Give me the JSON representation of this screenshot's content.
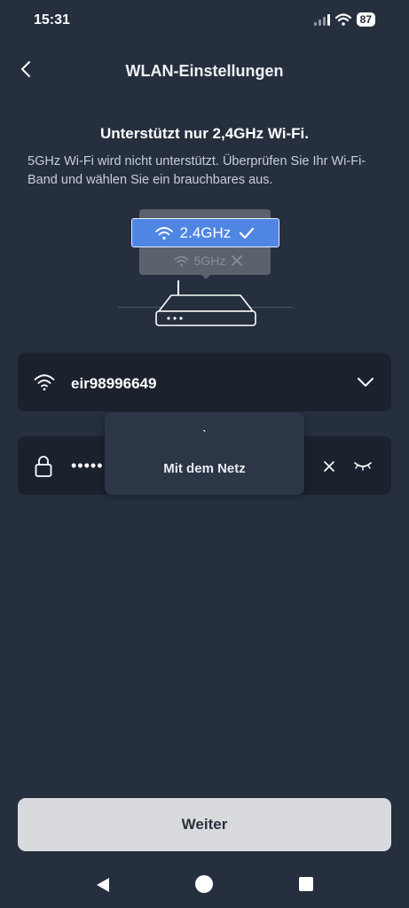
{
  "status_bar": {
    "time": "15:31",
    "battery": "87"
  },
  "header": {
    "title": "WLAN-Einstellungen"
  },
  "info": {
    "headline": "Unterstützt nur 2,4GHz Wi-Fi.",
    "description": "5GHz Wi-Fi wird nicht unterstützt. Überprüfen Sie Ihr Wi-Fi-Band und wählen Sie ein brauchbares aus."
  },
  "illustration": {
    "band_supported": "2.4GHz",
    "band_unsupported": "5GHz"
  },
  "wifi": {
    "ssid": "eir98996649"
  },
  "password": {
    "masked_value": "•••••"
  },
  "toast": {
    "spinner": "ˋ",
    "message": "Mit dem Netz"
  },
  "footer": {
    "next_label": "Weiter"
  },
  "colors": {
    "background": "#252f3e",
    "field": "#1b222e",
    "accent": "#4f86e4",
    "button": "#d8dadd"
  }
}
